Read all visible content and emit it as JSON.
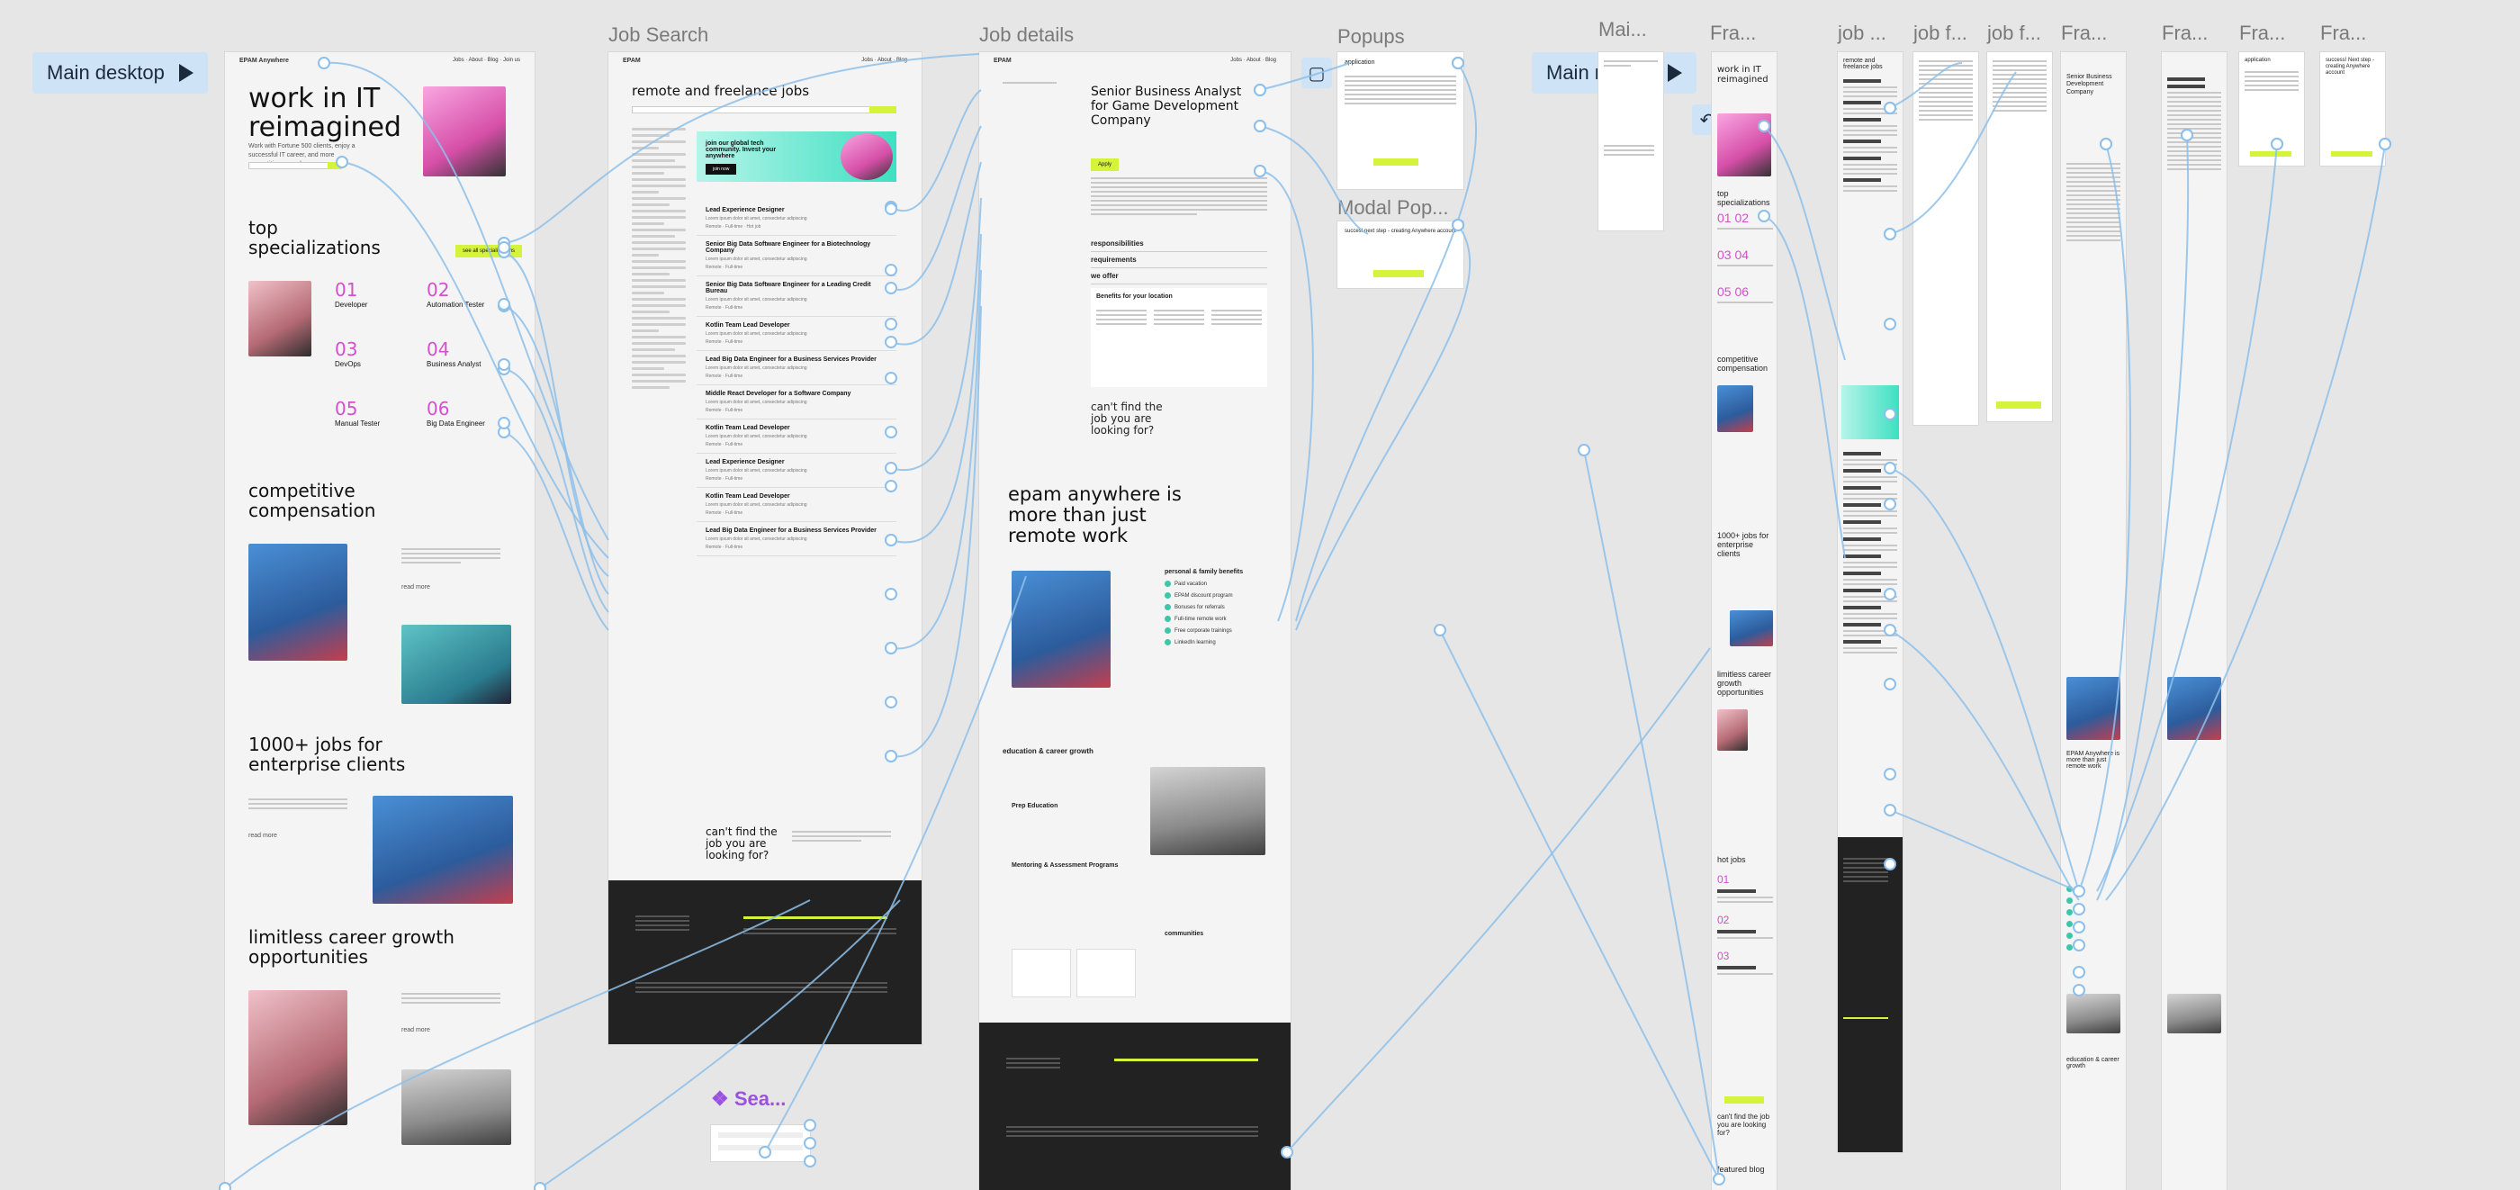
{
  "canvas": {
    "frame_labels": {
      "job_search": "Job Search",
      "job_details": "Job details",
      "popups": "Popups",
      "modal_popups": "Modal Pop...",
      "main_mobile_label": "Mai...",
      "fra1": "Fra...",
      "job1": "job ...",
      "jobf1": "job f...",
      "jobf2": "job f...",
      "fra2": "Fra...",
      "fra3": "Fra...",
      "fra4": "Fra...",
      "fra5": "Fra...",
      "search_overlay": "Sea..."
    },
    "flow_starts": {
      "main_desktop": "Main desktop",
      "main_mobile": "Main mobile"
    },
    "connector_color": "#8dbfe9",
    "accent_lime": "#d6f33c",
    "accent_pink": "#d54fcf"
  },
  "main_desktop": {
    "logo": "EPAM Anywhere",
    "hero_title": "work in IT reimagined",
    "hero_sub": "Work with Fortune 500 clients, enjoy a successful IT career, and more competitive rewards",
    "top_spec_title": "top specializations",
    "all_spec_btn": "see all specializations",
    "specs": [
      {
        "num": "01",
        "name": "Developer"
      },
      {
        "num": "02",
        "name": "Automation Tester"
      },
      {
        "num": "03",
        "name": "DevOps"
      },
      {
        "num": "04",
        "name": "Business Analyst"
      },
      {
        "num": "05",
        "name": "Manual Tester"
      },
      {
        "num": "06",
        "name": "Big Data Engineer"
      }
    ],
    "comp_title": "competitive compensation",
    "jobs_title": "1000+ jobs for enterprise clients",
    "growth_title": "limitless career growth opportunities",
    "read_more": "read more"
  },
  "job_search": {
    "title": "remote and freelance jobs",
    "banner": "join our global tech community. Invest your anywhere",
    "banner_btn": "join now",
    "jobs": [
      "Lead Experience Designer",
      "Senior Big Data Software Engineer for a Biotechnology Company",
      "Senior Big Data Software Engineer for a Leading Credit Bureau",
      "Kotlin Team Lead Developer",
      "Lead Big Data Engineer for a Business Services Provider",
      "Middle React Developer for a Software Company",
      "Kotlin Team Lead Developer",
      "Lead Experience Designer",
      "Kotlin Team Lead Developer",
      "Lead Big Data Engineer for a Business Services Provider"
    ],
    "cant_find": "can't find the job you are looking for?"
  },
  "job_details": {
    "title": "Senior Business Analyst for Game Development Company",
    "apply": "Apply",
    "responsibilities": "responsibilities",
    "requirements": "requirements",
    "we_offer": "we offer",
    "benefits_title": "Benefits for your location",
    "cant_find": "can't find the job you are looking for?",
    "epam_title": "epam anywhere is more than just remote work",
    "personal_benefits": "personal & family benefits",
    "benefits_list": [
      "Paid vacation",
      "EPAM discount program",
      "Bonuses for referrals",
      "Full-time remote work",
      "Free corporate trainings",
      "LinkedIn learning"
    ],
    "education_title": "education & career growth",
    "prog1": "Prep Education",
    "prog2": "Mentoring & Assessment Programs",
    "communities": "communities"
  },
  "popups": {
    "application": "application",
    "modal_text": "succes! next step - creating Anywhere account"
  },
  "mobile": {
    "hero": "work in IT reimagined",
    "top_spec": "top specializations",
    "comp": "competitive compensation",
    "jobs": "1000+ jobs for enterprise clients",
    "growth": "limitless career growth opportunities",
    "hot_jobs": "hot jobs",
    "cant_find": "can't find the job you are looking for?",
    "featured_blog": "featured blog",
    "jd_title": "Senior Business Development Company",
    "epam": "EPAM Anywhere is more than just remote work",
    "edu": "education & career growth",
    "success": "success! Next step - creating Anywhere account"
  }
}
